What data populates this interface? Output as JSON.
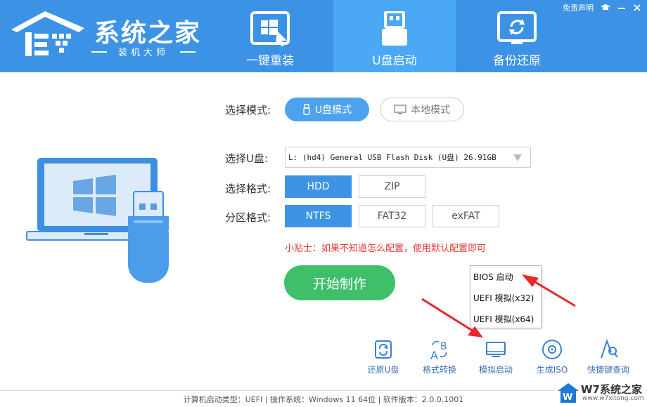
{
  "header": {
    "logo_title": "系统之家",
    "logo_subtitle": "装机大师",
    "tabs": [
      {
        "label": "一键重装",
        "icon": "windows-cursor-icon",
        "active": false
      },
      {
        "label": "U盘启动",
        "icon": "usb-drive-icon",
        "active": true
      },
      {
        "label": "备份还原",
        "icon": "backup-restore-icon",
        "active": false
      }
    ],
    "disclaimer": "免责声明",
    "top_icons": [
      "graduation-cap-icon",
      "minimize-icon",
      "close-icon"
    ]
  },
  "mode": {
    "label": "选择模式:",
    "options": [
      {
        "label": "U盘模式",
        "icon": "usb-icon",
        "selected": true
      },
      {
        "label": "本地模式",
        "icon": "monitor-icon",
        "selected": false
      }
    ]
  },
  "usb": {
    "label": "选择U盘:",
    "value": "L: (hd4) General USB Flash Disk (U盘) 26.91GB"
  },
  "format": {
    "label": "选择格式:",
    "options": [
      {
        "label": "HDD",
        "selected": true
      },
      {
        "label": "ZIP",
        "selected": false
      }
    ]
  },
  "partition": {
    "label": "分区格式:",
    "options": [
      {
        "label": "NTFS",
        "selected": true
      },
      {
        "label": "FAT32",
        "selected": false
      },
      {
        "label": "exFAT",
        "selected": false
      }
    ]
  },
  "tip": "小贴士：如果不知道怎么配置，使用默认配置即可",
  "start_button": "开始制作",
  "boot_menu": [
    "BIOS 启动",
    "UEFI 模拟(x32)",
    "UEFI 模拟(x64)"
  ],
  "tools": [
    {
      "label": "还原U盘",
      "icon": "restore-usb-icon"
    },
    {
      "label": "格式转换",
      "icon": "format-convert-icon"
    },
    {
      "label": "模拟启动",
      "icon": "simulate-boot-icon"
    },
    {
      "label": "生成ISO",
      "icon": "generate-iso-icon"
    },
    {
      "label": "快捷键查询",
      "icon": "hotkey-query-icon"
    }
  ],
  "footer": "计算机启动类型：UEFI | 操作系统：Windows 11 64位 | 软件版本：2.0.0.1001",
  "watermark": {
    "title": "W7系统之家",
    "subtitle": "www.w7xitong.com"
  },
  "colors": {
    "header": "#3c93e6",
    "accent": "#3d94e5",
    "start": "#3fbf6a",
    "tip": "#e83a3a",
    "arrow": "#e8282a"
  }
}
